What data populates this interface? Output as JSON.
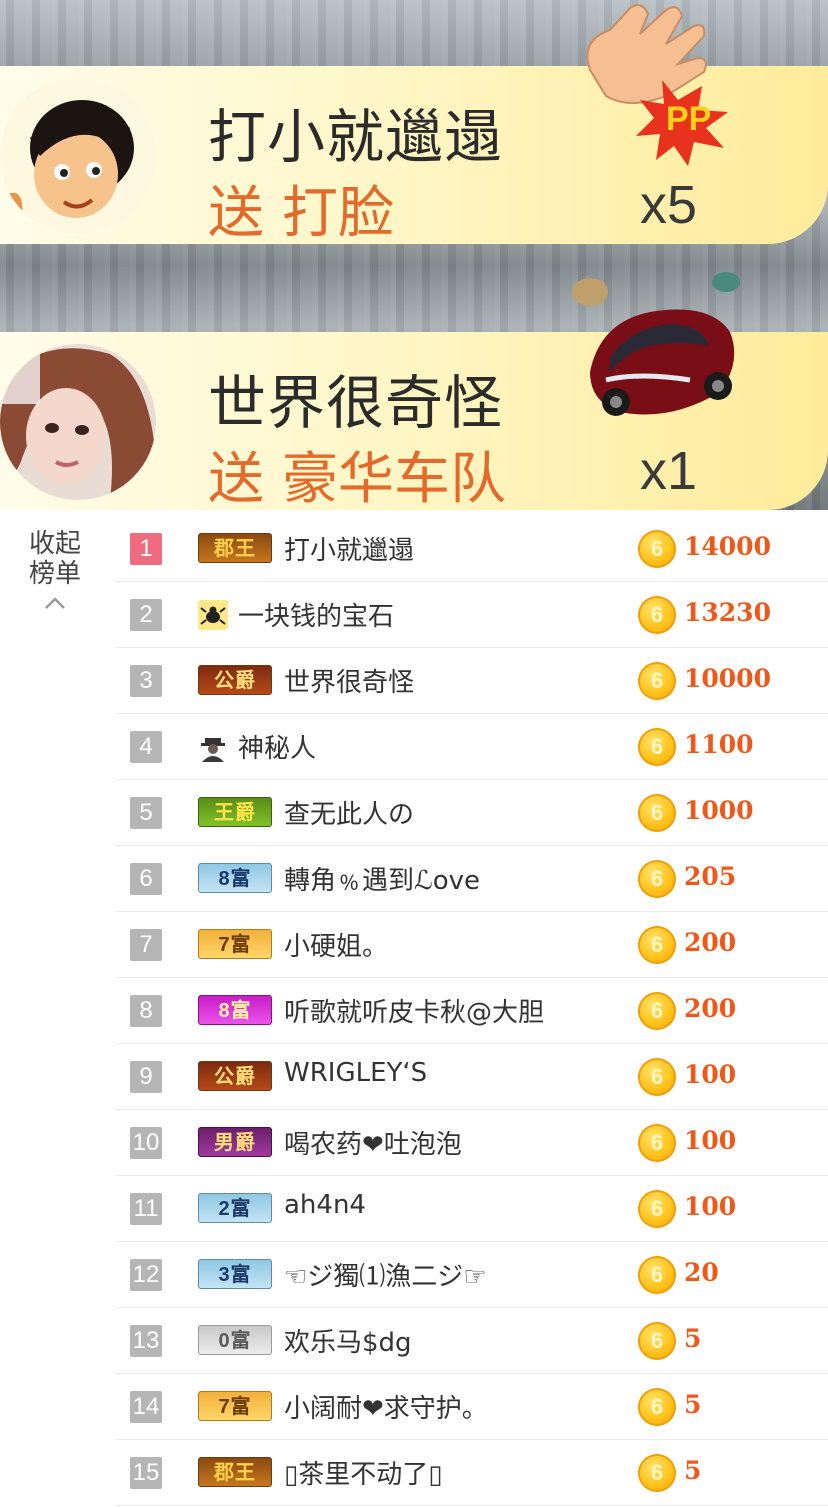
{
  "gift_banners": [
    {
      "sender": "打小就邋遢",
      "verb": "送",
      "gift": "打脸",
      "count": "x5",
      "avatar_icon": "cartoon-boy-avatar",
      "gift_icon": "slap-hand-icon"
    },
    {
      "sender": "世界很奇怪",
      "verb": "送",
      "gift": "豪华车队",
      "count": "x1",
      "avatar_icon": "woman-photo-avatar",
      "gift_icon": "luxury-car-icon"
    }
  ],
  "collapse": {
    "line1": "收起",
    "line2": "榜单",
    "icon": "chevron-up-icon"
  },
  "ranking": [
    {
      "rank": "1",
      "badge": "郡王",
      "badge_style": "b-jun",
      "name": "打小就邋遢",
      "amount": "14000"
    },
    {
      "rank": "2",
      "badge": "",
      "badge_style": "bee",
      "name": "一块钱的宝石",
      "amount": "13230"
    },
    {
      "rank": "3",
      "badge": "公爵",
      "badge_style": "b-gong",
      "name": "世界很奇怪",
      "amount": "10000"
    },
    {
      "rank": "4",
      "badge": "",
      "badge_style": "mystery",
      "name": "神秘人",
      "amount": "1100"
    },
    {
      "rank": "5",
      "badge": "王爵",
      "badge_style": "b-wang",
      "name": "查无此人の",
      "amount": "1000"
    },
    {
      "rank": "6",
      "badge": "8富",
      "badge_style": "b-fu-blue",
      "name": "轉角﹪遇到ℒove",
      "amount": "205"
    },
    {
      "rank": "7",
      "badge": "7富",
      "badge_style": "b-fu-gold",
      "name": "小硬姐。",
      "amount": "200"
    },
    {
      "rank": "8",
      "badge": "8富",
      "badge_style": "b-fu-pink",
      "name": "听歌就听皮卡秋@大胆",
      "amount": "200"
    },
    {
      "rank": "9",
      "badge": "公爵",
      "badge_style": "b-gong",
      "name": "WRIGLEY‘S",
      "amount": "100"
    },
    {
      "rank": "10",
      "badge": "男爵",
      "badge_style": "b-nan",
      "name": "喝农药❤吐泡泡",
      "amount": "100"
    },
    {
      "rank": "11",
      "badge": "2富",
      "badge_style": "b-fu-blue",
      "name": "ah4n4",
      "amount": "100"
    },
    {
      "rank": "12",
      "badge": "3富",
      "badge_style": "b-fu-blue",
      "name": "☜ジ獨⑴漁二ジ☞",
      "amount": "20"
    },
    {
      "rank": "13",
      "badge": "0富",
      "badge_style": "b-fu-gray",
      "name": "欢乐马$dg",
      "amount": "5"
    },
    {
      "rank": "14",
      "badge": "7富",
      "badge_style": "b-fu-gold",
      "name": "小阔耐❤求守护。",
      "amount": "5"
    },
    {
      "rank": "15",
      "badge": "郡王",
      "badge_style": "b-jun",
      "name": "▯茶里不动了▯",
      "amount": "5"
    }
  ],
  "coin_symbol": "6",
  "colors": {
    "amount": "#f0581a",
    "gift_text": "#e36a2a",
    "rank_top": "#f06b7d",
    "rank_default": "#b5b5b5"
  }
}
